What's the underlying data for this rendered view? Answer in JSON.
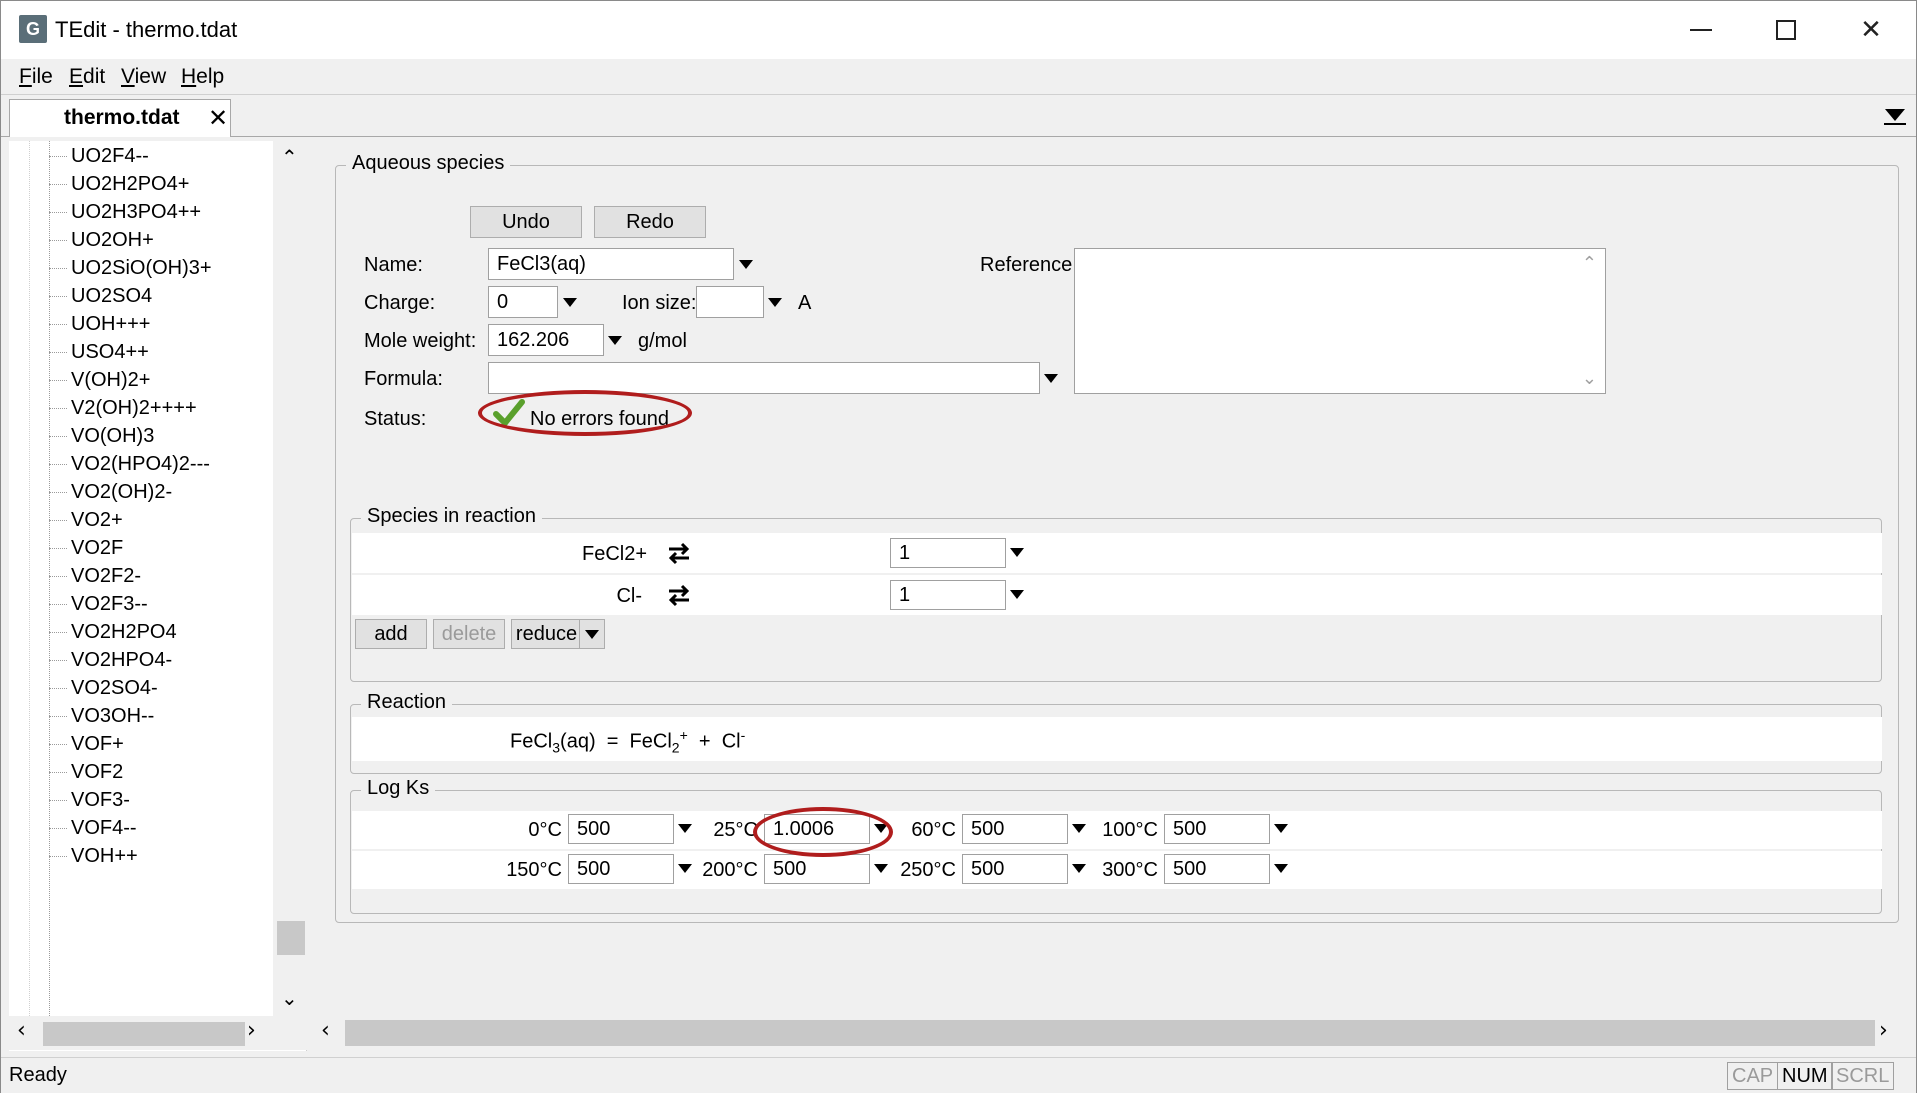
{
  "window": {
    "title": "TEdit - thermo.tdat",
    "app_icon_glyph": "G"
  },
  "menu": {
    "file": "File",
    "file_u": "F",
    "file_rest": "ile",
    "edit_u": "E",
    "edit_rest": "dit",
    "view_u": "V",
    "view_rest": "iew",
    "help_u": "H",
    "help_rest": "elp"
  },
  "tab": {
    "label": "thermo.tdat",
    "close": "✕"
  },
  "tree": {
    "items": [
      "UO2F4--",
      "UO2H2PO4+",
      "UO2H3PO4++",
      "UO2OH+",
      "UO2SiO(OH)3+",
      "UO2SO4",
      "UOH+++",
      "USO4++",
      "V(OH)2+",
      "V2(OH)2++++",
      "VO(OH)3",
      "VO2(HPO4)2---",
      "VO2(OH)2-",
      "VO2+",
      "VO2F",
      "VO2F2-",
      "VO2F3--",
      "VO2H2PO4",
      "VO2HPO4-",
      "VO2SO4-",
      "VO3OH--",
      "VOF+",
      "VOF2",
      "VOF3-",
      "VOF4--",
      "VOH++"
    ]
  },
  "aqueous": {
    "legend": "Aqueous species",
    "undo": "Undo",
    "redo": "Redo",
    "name_label": "Name:",
    "name_value": "FeCl3(aq)",
    "reference_label": "Reference:",
    "charge_label": "Charge:",
    "charge_value": "0",
    "ion_size_label": "Ion size:",
    "ion_size_value": "",
    "ion_size_unit": "A",
    "mole_weight_label": "Mole weight:",
    "mole_weight_value": "162.206",
    "mole_weight_unit": "g/mol",
    "formula_label": "Formula:",
    "formula_value": "",
    "status_label": "Status:",
    "status_value": "No errors found"
  },
  "species_in_reaction": {
    "legend": "Species in reaction",
    "rows": [
      {
        "species": "FeCl2+",
        "coef": "1"
      },
      {
        "species": "Cl-",
        "coef": "1"
      }
    ],
    "add": "add",
    "delete": "delete",
    "reduce": "reduce"
  },
  "reaction": {
    "legend": "Reaction",
    "lhs_base": "FeCl",
    "lhs_sub": "3",
    "lhs_tail": "(aq)",
    "eq": "=",
    "p1_base": "FeCl",
    "p1_sub": "2",
    "p1_sup": "+",
    "plus": "+",
    "p2_base": "Cl",
    "p2_sup": "-"
  },
  "logks": {
    "legend": "Log Ks",
    "row1": [
      {
        "temp": "0°C",
        "value": "500"
      },
      {
        "temp": "25°C",
        "value": "1.0006"
      },
      {
        "temp": "60°C",
        "value": "500"
      },
      {
        "temp": "100°C",
        "value": "500"
      }
    ],
    "row2": [
      {
        "temp": "150°C",
        "value": "500"
      },
      {
        "temp": "200°C",
        "value": "500"
      },
      {
        "temp": "250°C",
        "value": "500"
      },
      {
        "temp": "300°C",
        "value": "500"
      }
    ]
  },
  "statusbar": {
    "text": "Ready",
    "cap": "CAP",
    "num": "NUM",
    "scrl": "SCRL"
  },
  "colors": {
    "highlight": "#b01d1d",
    "check": "#5aa02c"
  }
}
